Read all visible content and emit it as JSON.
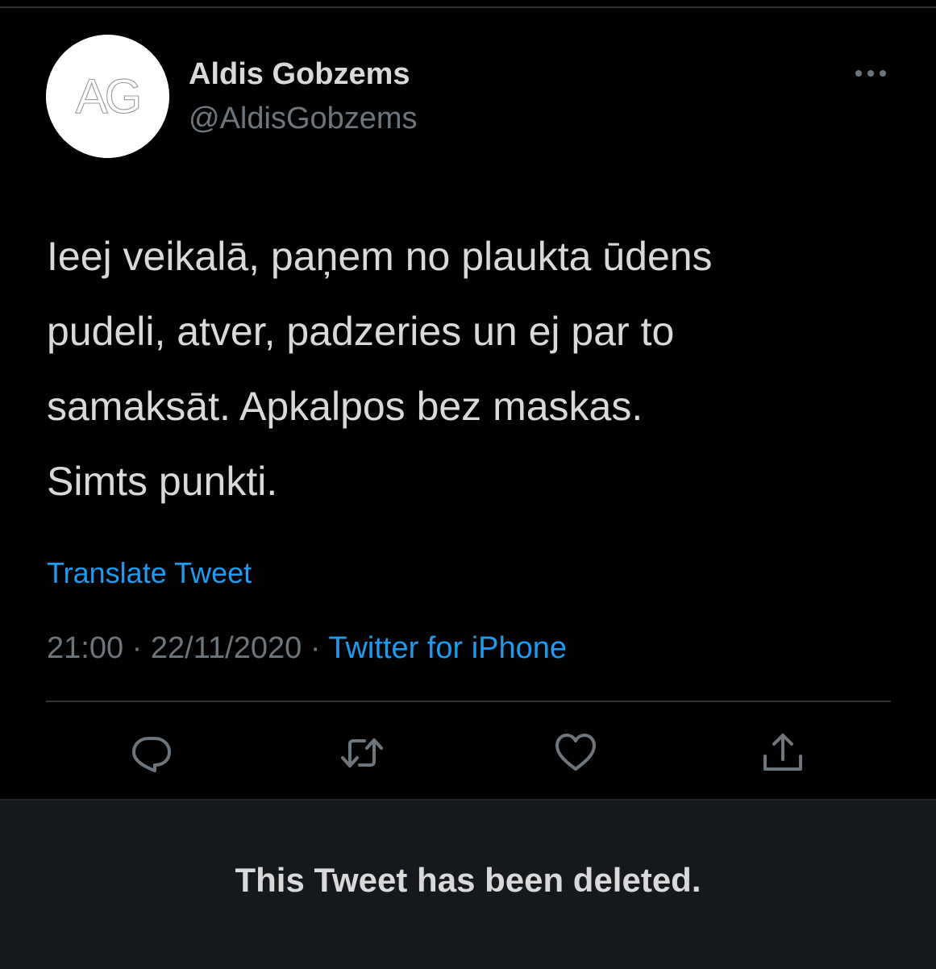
{
  "author": {
    "avatar_text": "AG",
    "display_name": "Aldis Gobzems",
    "handle": "@AldisGobzems"
  },
  "more_icon": "ellipsis-icon",
  "tweet": {
    "lines": [
      "Ieej veikalā, paņem no plaukta ūdens",
      "pudeli, atver, padzeries un ej par to",
      "samaksāt. Apkalpos bez maskas.",
      "Simts punkti."
    ],
    "translate_label": "Translate Tweet",
    "time": "21:00",
    "separator": "·",
    "date": "22/11/2020",
    "source": "Twitter for iPhone"
  },
  "actions": [
    {
      "icon": "reply-icon"
    },
    {
      "icon": "retweet-icon"
    },
    {
      "icon": "like-icon"
    },
    {
      "icon": "share-icon"
    }
  ],
  "notice": {
    "text": "This Tweet has been deleted."
  },
  "colors": {
    "background": "#000000",
    "text": "#d9d9d9",
    "secondary": "#6e767d",
    "accent": "#1d9bf0",
    "banner": "#15181c"
  }
}
